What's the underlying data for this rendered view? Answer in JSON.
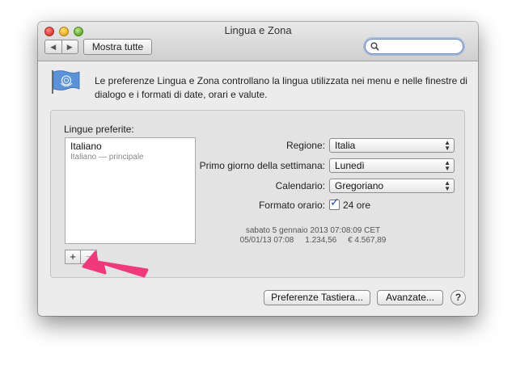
{
  "window": {
    "title": "Lingua e Zona"
  },
  "toolbar": {
    "back_glyph": "◀",
    "forward_glyph": "▶",
    "show_all_label": "Mostra tutte",
    "search_value": "",
    "search_placeholder": ""
  },
  "header": {
    "description": "Le preferenze Lingua e Zona controllano la lingua utilizzata nei menu e nelle finestre di dialogo e i formati di date, orari e valute."
  },
  "languages": {
    "label": "Lingue preferite:",
    "items": [
      {
        "name": "Italiano",
        "detail": "Italiano — principale"
      }
    ],
    "add_label": "+",
    "remove_label": "−"
  },
  "settings": {
    "region": {
      "label": "Regione:",
      "value": "Italia"
    },
    "first_day": {
      "label": "Primo giorno della settimana:",
      "value": "Lunedì"
    },
    "calendar": {
      "label": "Calendario:",
      "value": "Gregoriano"
    },
    "time_format": {
      "label": "Formato orario:",
      "checkbox_label": "24 ore",
      "checked": true
    }
  },
  "sample": {
    "line1": "sabato 5 gennaio 2013 07:08:09 CET",
    "line2": "05/01/13 07:08     1.234,56     € 4.567,89"
  },
  "footer": {
    "keyboard_button": "Preferenze Tastiera...",
    "advanced_button": "Avanzate...",
    "help_label": "?"
  },
  "colors": {
    "annotation_arrow": "#f0397a",
    "focus_ring": "#6f8fc0"
  }
}
